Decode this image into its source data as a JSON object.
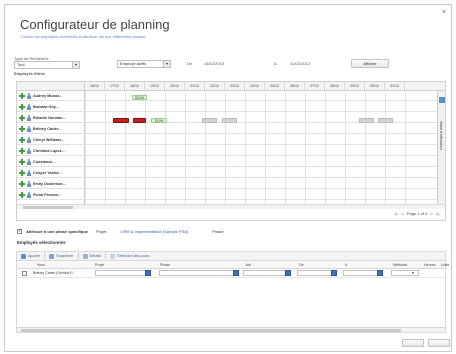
{
  "dialog": {
    "title": "Configurateur de planning",
    "subtitle": "Choisir les employés concernés et attribuer les aux différentes phases",
    "close_icon": "×"
  },
  "filters": {
    "type_label": "Type de Recherche",
    "type_value": "Tout",
    "employees_label": "Employés filtrés",
    "status_value": "Employé actifs",
    "from_label": "De",
    "from_value": "16/02/2013",
    "to_label": "A",
    "to_value": "31/02/2013",
    "show_button": "Afficher"
  },
  "grid": {
    "days": [
      "16/12",
      "17/12",
      "18/12",
      "19/12",
      "20/12",
      "21/12",
      "22/12",
      "23/12",
      "24/12",
      "25/12",
      "26/12",
      "27/12",
      "28/12",
      "29/12",
      "30/12",
      "31/12"
    ],
    "employees": [
      "Audrey Munoz...",
      "Barbara Guy...",
      "Britanie Norman...",
      "Britney Carter...",
      "Cheryl Williams...",
      "Christina Lopez...",
      "Constance...",
      "Cooper Vocha...",
      "Emily Dickerson...",
      "Fiona Preston..."
    ],
    "bar_labels": {
      "b1": "80.0%",
      "b2": "75.0%"
    },
    "side_panel_label": "Statut d'affectation",
    "pager": {
      "first": "|<",
      "prev": "<",
      "page_text": "Page 1 of 4",
      "next": ">",
      "last": ">|"
    }
  },
  "assoc": {
    "checkbox_label": "Attribuer à une phase spécifique",
    "project_label": "Projet",
    "project_value": "CRM & Implementation (Sample PSA)",
    "phase_label": "Phase"
  },
  "selected": {
    "heading": "Employés sélectionnés",
    "toolbar": {
      "add": "Ajouter",
      "delete": "Supprimer",
      "details": "Détails",
      "select_days": "Sélection des jours"
    },
    "columns": [
      "Nom",
      "Projet",
      "Phase",
      "Jod",
      "De",
      "A",
      "Méthode",
      "Heures",
      "Unité"
    ],
    "rows": [
      {
        "name": "Britney Carter (Service P..."
      }
    ]
  },
  "colors": {
    "red_bar": "#c81e1e",
    "green_bar": "#dff2d8",
    "gray_bar": "#d4d4d4",
    "accent": "#2a56b3"
  }
}
